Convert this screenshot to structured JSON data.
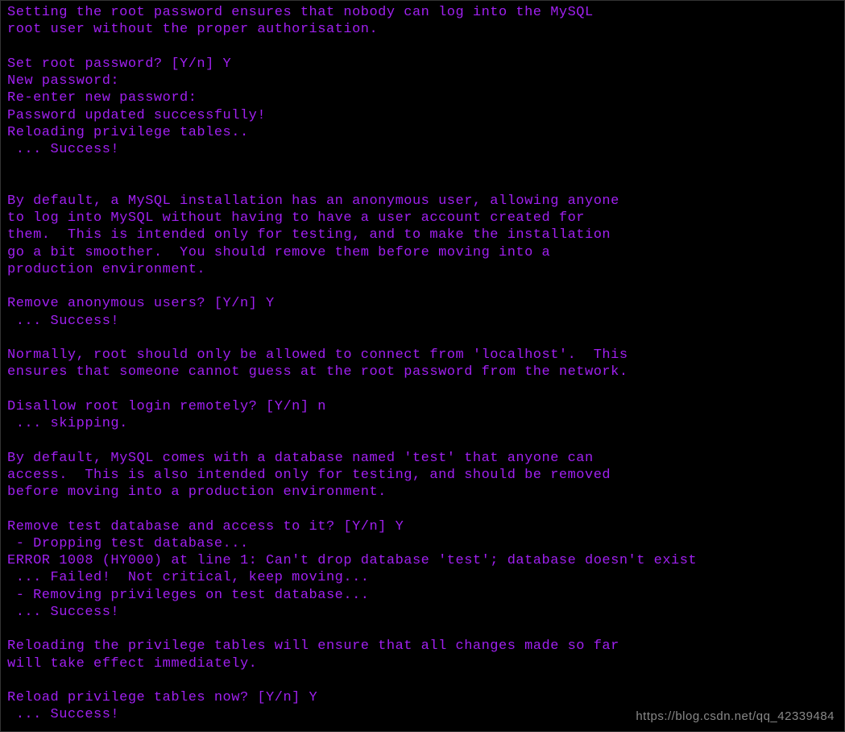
{
  "terminal": {
    "lines": [
      "Setting the root password ensures that nobody can log into the MySQL",
      "root user without the proper authorisation.",
      "",
      "Set root password? [Y/n] Y",
      "New password:",
      "Re-enter new password:",
      "Password updated successfully!",
      "Reloading privilege tables..",
      " ... Success!",
      "",
      "",
      "By default, a MySQL installation has an anonymous user, allowing anyone",
      "to log into MySQL without having to have a user account created for",
      "them.  This is intended only for testing, and to make the installation",
      "go a bit smoother.  You should remove them before moving into a",
      "production environment.",
      "",
      "Remove anonymous users? [Y/n] Y",
      " ... Success!",
      "",
      "Normally, root should only be allowed to connect from 'localhost'.  This",
      "ensures that someone cannot guess at the root password from the network.",
      "",
      "Disallow root login remotely? [Y/n] n",
      " ... skipping.",
      "",
      "By default, MySQL comes with a database named 'test' that anyone can",
      "access.  This is also intended only for testing, and should be removed",
      "before moving into a production environment.",
      "",
      "Remove test database and access to it? [Y/n] Y",
      " - Dropping test database...",
      "ERROR 1008 (HY000) at line 1: Can't drop database 'test'; database doesn't exist",
      " ... Failed!  Not critical, keep moving...",
      " - Removing privileges on test database...",
      " ... Success!",
      "",
      "Reloading the privilege tables will ensure that all changes made so far",
      "will take effect immediately.",
      "",
      "Reload privilege tables now? [Y/n] Y",
      " ... Success!"
    ]
  },
  "watermark": "https://blog.csdn.net/qq_42339484"
}
